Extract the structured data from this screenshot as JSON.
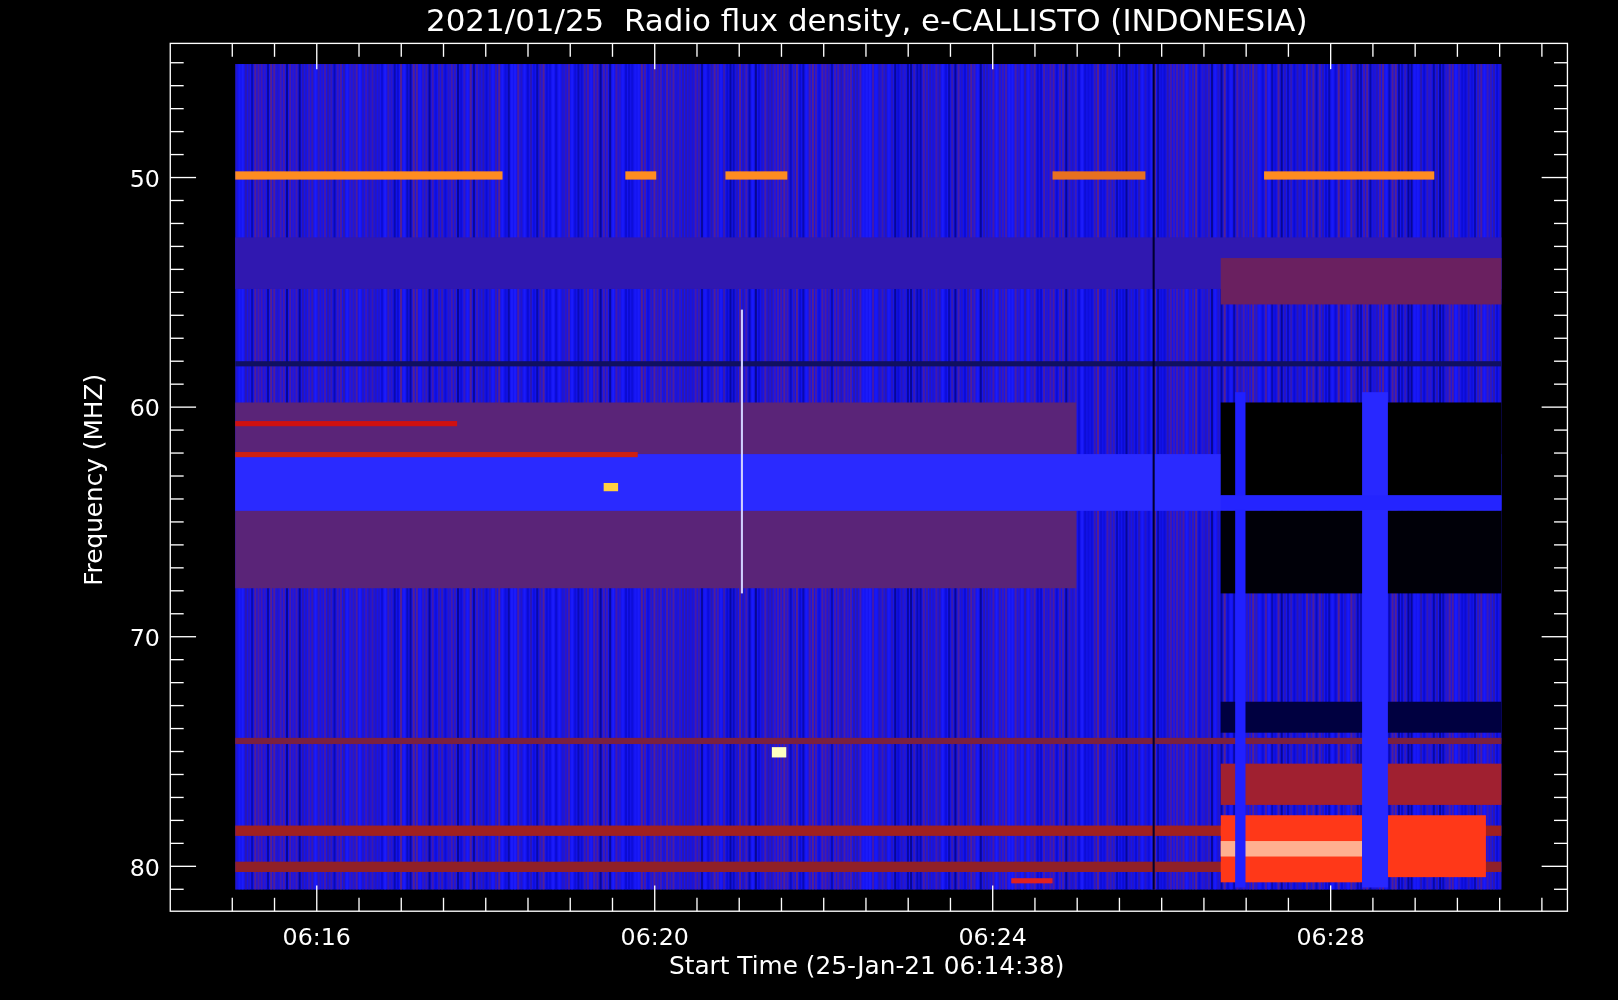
{
  "title": "2021/01/25  Radio flux density, e-CALLISTO (INDONESIA)",
  "y_axis": {
    "label": "Frequency (MHZ)",
    "ticks": [
      "50",
      "60",
      "70",
      "80"
    ]
  },
  "x_axis": {
    "label": "Start Time (25-Jan-21 06:14:38)",
    "ticks": [
      "06:16",
      "06:20",
      "06:24",
      "06:28"
    ]
  }
}
